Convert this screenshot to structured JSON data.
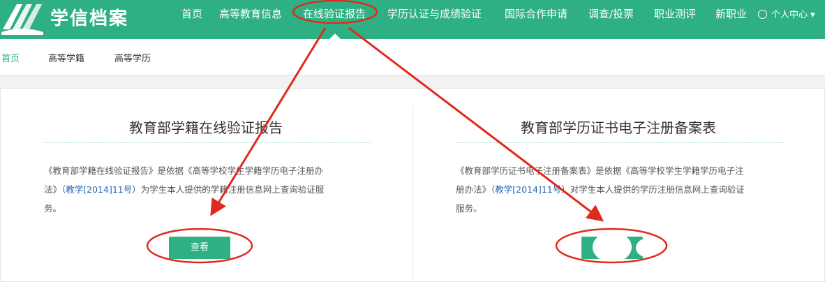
{
  "header": {
    "logo_text": "学信档案",
    "nav": [
      {
        "label": "首页"
      },
      {
        "label": "高等教育信息"
      },
      {
        "label": "在线验证报告"
      },
      {
        "label": "学历认证与成绩验证"
      },
      {
        "label": "国际合作申请"
      },
      {
        "label": "调查/投票"
      },
      {
        "label": "职业测评"
      },
      {
        "label": "新职业"
      }
    ],
    "user_center": "个人中心",
    "user_caret": "▾"
  },
  "subnav": [
    {
      "label": "首页"
    },
    {
      "label": "高等学籍"
    },
    {
      "label": "高等学历"
    }
  ],
  "cards": [
    {
      "title": "教育部学籍在线验证报告",
      "desc_lines": [
        {
          "pre": "《教育部学籍在线验证报告》是依据《高等学校学生学籍学历电子注册办",
          "link": "",
          "post": ""
        },
        {
          "pre": "法》（",
          "link": "教学[2014]11号",
          "post": "）为学生本人提供的学籍注册信息网上查询验证服"
        },
        {
          "pre": "务。",
          "link": "",
          "post": ""
        }
      ],
      "button": "查看"
    },
    {
      "title": "教育部学历证书电子注册备案表",
      "desc_lines": [
        {
          "pre": "《教育部学历证书电子注册备案表》是依据《高等学校学生学籍学历电子注",
          "link": "",
          "post": ""
        },
        {
          "pre": "册办法》（",
          "link": "教学[2014]11号",
          "post": "）对学生本人提供的学历注册信息网上查询验证"
        },
        {
          "pre": "服务。",
          "link": "",
          "post": ""
        }
      ],
      "button": ""
    }
  ],
  "colors": {
    "brand": "#2fb083",
    "annotation": "#e02a1e",
    "link": "#2a66b6"
  }
}
